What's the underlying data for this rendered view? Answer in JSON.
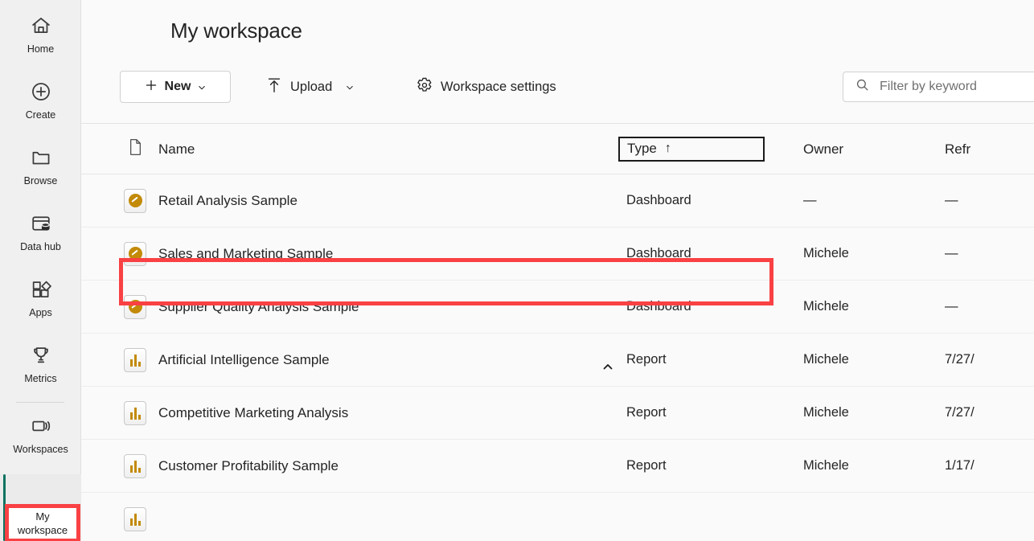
{
  "sidebar": {
    "items": [
      {
        "label": "Home",
        "icon": "home-icon"
      },
      {
        "label": "Create",
        "icon": "plus-circle-icon"
      },
      {
        "label": "Browse",
        "icon": "folder-icon"
      },
      {
        "label": "Data hub",
        "icon": "data-hub-icon"
      },
      {
        "label": "Apps",
        "icon": "apps-icon"
      },
      {
        "label": "Metrics",
        "icon": "trophy-icon"
      },
      {
        "label": "Workspaces",
        "icon": "workspaces-icon"
      }
    ],
    "selected": {
      "label_line1": "My",
      "label_line2": "workspace",
      "accent_color": "#0f7361"
    }
  },
  "header": {
    "title": "My workspace"
  },
  "toolbar": {
    "new_label": "New",
    "new_icon": "plus-icon",
    "new_chevron": "chevron-down-icon",
    "upload_label": "Upload",
    "upload_icon": "upload-arrow-icon",
    "upload_chevron": "chevron-down-icon",
    "settings_label": "Workspace settings",
    "settings_icon": "gear-icon"
  },
  "search": {
    "placeholder": "Filter by keyword",
    "value": "",
    "icon": "search-icon"
  },
  "table": {
    "columns": {
      "icon": "document-icon",
      "name": "Name",
      "type": "Type",
      "owner": "Owner",
      "refreshed": "Refr"
    },
    "sort": {
      "column": "Type",
      "direction": "ascending",
      "arrow": "↑"
    },
    "rows": [
      {
        "icon": "dashboard-icon",
        "name": "Retail Analysis Sample",
        "type": "Dashboard",
        "owner": "—",
        "refreshed": "—",
        "highlighted": false
      },
      {
        "icon": "dashboard-icon",
        "name": "Sales and Marketing Sample",
        "type": "Dashboard",
        "owner": "Michele",
        "refreshed": "—",
        "highlighted": true
      },
      {
        "icon": "dashboard-icon",
        "name": "Supplier Quality Analysis Sample",
        "type": "Dashboard",
        "owner": "Michele",
        "refreshed": "—",
        "highlighted": false
      },
      {
        "icon": "report-icon",
        "name": "Artificial Intelligence Sample",
        "type": "Report",
        "owner": "Michele",
        "refreshed": "7/27/",
        "highlighted": false
      },
      {
        "icon": "report-icon",
        "name": "Competitive Marketing Analysis",
        "type": "Report",
        "owner": "Michele",
        "refreshed": "7/27/",
        "highlighted": false
      },
      {
        "icon": "report-icon",
        "name": "Customer Profitability Sample",
        "type": "Report",
        "owner": "Michele",
        "refreshed": "1/17/",
        "highlighted": false
      }
    ]
  },
  "highlight": {
    "color": "#f94144"
  }
}
